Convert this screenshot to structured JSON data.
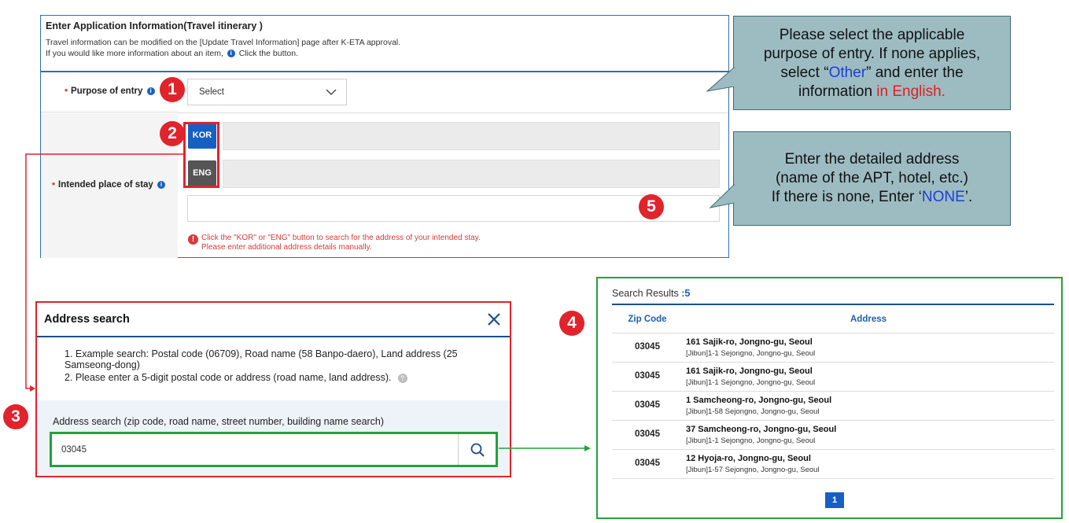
{
  "form": {
    "title": "Enter Application Information(Travel itinerary )",
    "desc_line1": "Travel information can be modified on the [Update Travel Information] page after K-ETA approval.",
    "desc_line2_before": "If you would like more information about an item,",
    "desc_line2_after": "Click the button.",
    "purpose_label": "Purpose of entry",
    "purpose_select_value": "Select",
    "stay_label": "Intended place of stay",
    "kor_button": "KOR",
    "eng_button": "ENG",
    "warning_line1": "Click the \"KOR\" or \"ENG\" button to search for the address of your intended stay.",
    "warning_line2": "Please enter additional address details manually."
  },
  "callout1": {
    "line1": "Please select the applicable",
    "line2": "purpose of entry. If none applies,",
    "line3_before": "select “",
    "line3_highlight": "Other",
    "line3_after": "” and enter the",
    "line4_before": "information ",
    "line4_highlight": "in English."
  },
  "callout2": {
    "line1": "Enter the detailed address",
    "line2": "(name of the APT, hotel, etc.)",
    "line3_before": "If there is none, Enter ‘",
    "line3_highlight": "NONE",
    "line3_after": "’."
  },
  "markers": [
    "1",
    "2",
    "3",
    "4",
    "5"
  ],
  "dialog": {
    "title": "Address search",
    "example1": "1. Example search: Postal code (06709), Road name (58 Banpo-daero), Land address (25 Samseong-dong)",
    "example2": "2. Please enter a 5-digit postal code or address (road name, land address).",
    "search_label": "Address search (zip code, road name, street number, building name search)",
    "search_value": "03045"
  },
  "results": {
    "title": "Search Results",
    "count": ":5",
    "col_zip": "Zip Code",
    "col_address": "Address",
    "rows": [
      {
        "zip": "03045",
        "road": "161 Sajik-ro, Jongno-gu, Seoul",
        "jibun": "[Jibun]1-1 Sejongno, Jongno-gu, Seoul"
      },
      {
        "zip": "03045",
        "road": "161 Sajik-ro, Jongno-gu, Seoul",
        "jibun": "[Jibun]1-1 Sejongno, Jongno-gu, Seoul"
      },
      {
        "zip": "03045",
        "road": "1 Samcheong-ro, Jongno-gu, Seoul",
        "jibun": "[Jibun]1-58 Sejongno, Jongno-gu, Seoul"
      },
      {
        "zip": "03045",
        "road": "37 Samcheong-ro, Jongno-gu, Seoul",
        "jibun": "[Jibun]1-1 Sejongno, Jongno-gu, Seoul"
      },
      {
        "zip": "03045",
        "road": "12 Hyoja-ro, Jongno-gu, Seoul",
        "jibun": "[Jibun]1-57 Sejongno, Jongno-gu, Seoul"
      }
    ],
    "page": "1"
  },
  "icons": [
    "info-icon",
    "chevron-down-icon",
    "warning-icon",
    "close-icon",
    "search-icon",
    "help-icon"
  ],
  "colors": {
    "primary_blue": "#1660c4",
    "highlight_red": "#e1232b",
    "highlight_green": "#22a33a",
    "callout_bg": "#9dbcc2"
  }
}
